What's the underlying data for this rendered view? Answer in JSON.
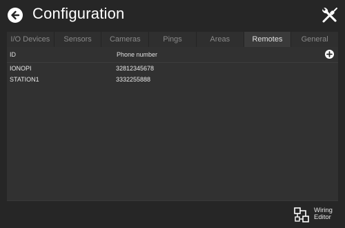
{
  "header": {
    "title": "Configuration"
  },
  "tabs": [
    {
      "label": "I/O Devices",
      "active": false
    },
    {
      "label": "Sensors",
      "active": false
    },
    {
      "label": "Cameras",
      "active": false
    },
    {
      "label": "Pings",
      "active": false
    },
    {
      "label": "Areas",
      "active": false
    },
    {
      "label": "Remotes",
      "active": true
    },
    {
      "label": "General",
      "active": false
    }
  ],
  "table": {
    "columns": [
      "ID",
      "Phone number"
    ],
    "rows": [
      {
        "id": "IONOPI",
        "phone": "32812345678"
      },
      {
        "id": "STATION1",
        "phone": "3332255888"
      }
    ]
  },
  "footer": {
    "wiring_label_line1": "Wiring",
    "wiring_label_line2": "Editor"
  },
  "colors": {
    "background": "#262626",
    "panel": "#313131",
    "active_tab": "#3a3a3a",
    "text": "#e6e6e6"
  }
}
